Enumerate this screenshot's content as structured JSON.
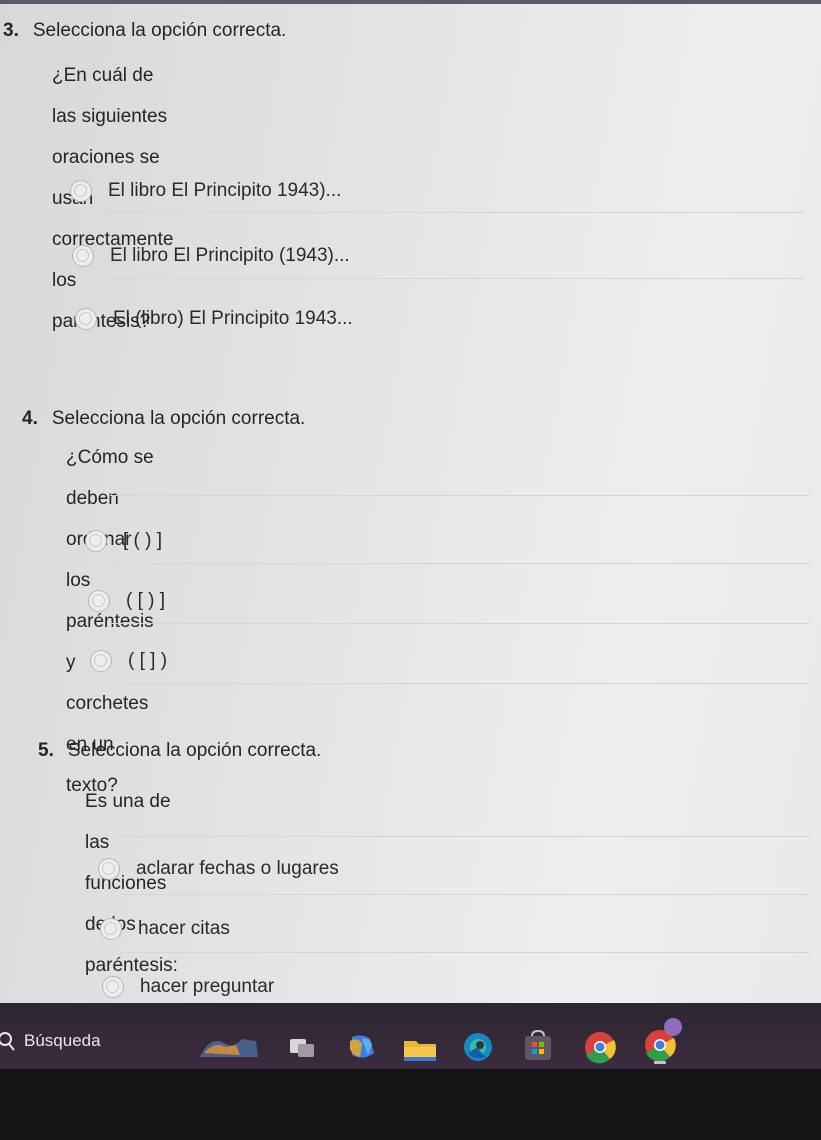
{
  "questions": [
    {
      "number": "3.",
      "title": "Selecciona la opción correcta.",
      "prompt_lines": [
        "¿En cuál de las siguientes oraciones se usan correctamente los",
        "paréntesis?"
      ],
      "options": [
        "El libro El Principito 1943)...",
        "El libro El Principito (1943)...",
        "El (libro) El Principito 1943..."
      ]
    },
    {
      "number": "4.",
      "title": "Selecciona la opción correcta.",
      "prompt_lines": [
        "¿Cómo se deben ordenar los paréntesis y corchetes en un texto?"
      ],
      "options": [
        "[ ( ) ]",
        "( [ ) ]",
        "( [ ] )"
      ]
    },
    {
      "number": "5.",
      "title": "Selecciona la opción correcta.",
      "prompt_lines": [
        "Es una de las funciones de los paréntesis:"
      ],
      "options": [
        "aclarar fechas o lugares",
        "hacer citas",
        "hacer preguntar"
      ]
    }
  ],
  "taskbar": {
    "search_label": "Búsqueda",
    "icons": [
      "search-icon",
      "widgets-icon",
      "task-view-icon",
      "copilot-icon",
      "file-explorer-icon",
      "edge-icon",
      "store-icon",
      "chrome-icon",
      "chrome-profile-icon"
    ]
  }
}
